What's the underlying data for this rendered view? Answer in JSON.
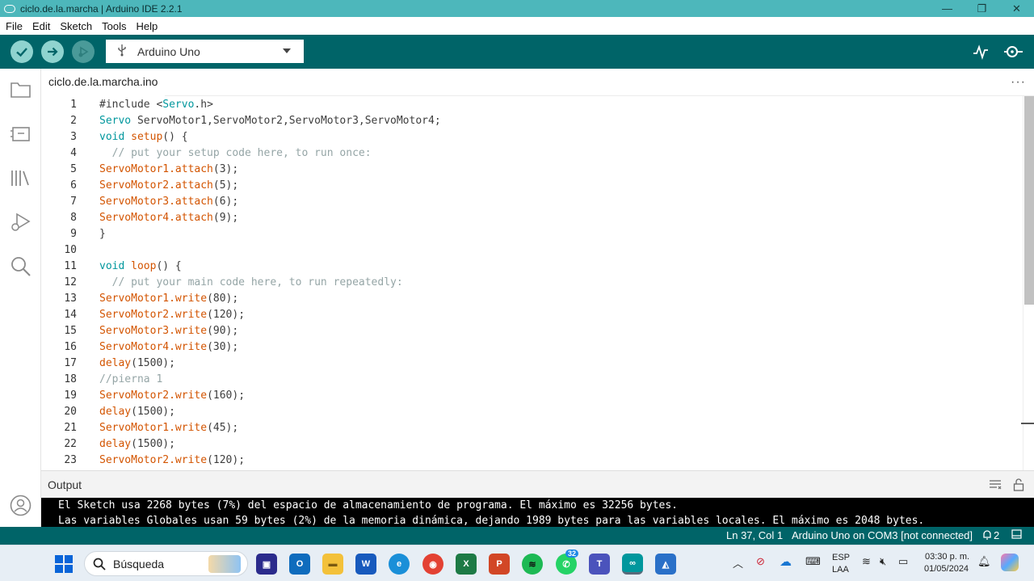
{
  "window": {
    "title": "ciclo.de.la.marcha | Arduino IDE 2.2.1",
    "minimize": "—",
    "restore": "❐",
    "close": "✕"
  },
  "menu": [
    "File",
    "Edit",
    "Sketch",
    "Tools",
    "Help"
  ],
  "toolbar": {
    "board": "Arduino Uno",
    "verify_icon": "check-icon",
    "upload_icon": "arrow-right-icon",
    "debug_icon": "debug-icon",
    "serial_plotter_icon": "pulse-icon",
    "serial_monitor_icon": "magnifier-icon"
  },
  "tab": {
    "filename": "ciclo.de.la.marcha.ino",
    "more": "···"
  },
  "code": [
    {
      "n": "1",
      "text": "#include <Servo.h>"
    },
    {
      "n": "2",
      "text": "Servo ServoMotor1,ServoMotor2,ServoMotor3,ServoMotor4;"
    },
    {
      "n": "3",
      "text": "void setup() {"
    },
    {
      "n": "4",
      "text": "  // put your setup code here, to run once:"
    },
    {
      "n": "5",
      "text": "ServoMotor1.attach(3);"
    },
    {
      "n": "6",
      "text": "ServoMotor2.attach(5);"
    },
    {
      "n": "7",
      "text": "ServoMotor3.attach(6);"
    },
    {
      "n": "8",
      "text": "ServoMotor4.attach(9);"
    },
    {
      "n": "9",
      "text": "}"
    },
    {
      "n": "10",
      "text": ""
    },
    {
      "n": "11",
      "text": "void loop() {"
    },
    {
      "n": "12",
      "text": "  // put your main code here, to run repeatedly:"
    },
    {
      "n": "13",
      "text": "ServoMotor1.write(80);"
    },
    {
      "n": "14",
      "text": "ServoMotor2.write(120);"
    },
    {
      "n": "15",
      "text": "ServoMotor3.write(90);"
    },
    {
      "n": "16",
      "text": "ServoMotor4.write(30);"
    },
    {
      "n": "17",
      "text": "delay(1500);"
    },
    {
      "n": "18",
      "text": "//pierna 1"
    },
    {
      "n": "19",
      "text": "ServoMotor2.write(160);"
    },
    {
      "n": "20",
      "text": "delay(1500);"
    },
    {
      "n": "21",
      "text": "ServoMotor1.write(45);"
    },
    {
      "n": "22",
      "text": "delay(1500);"
    },
    {
      "n": "23",
      "text": "ServoMotor2.write(120);"
    }
  ],
  "output": {
    "label": "Output",
    "lines": [
      "El Sketch usa 2268 bytes (7%) del espacio de almacenamiento de programa. El máximo es 32256 bytes.",
      "Las variables Globales usan 59 bytes (2%) de la memoria dinámica, dejando 1989 bytes para las variables locales. El máximo es 2048 bytes."
    ]
  },
  "status": {
    "position": "Ln 37, Col 1",
    "board": "Arduino Uno on COM3 [not connected]",
    "notifications": "2"
  },
  "taskbar": {
    "search_placeholder": "Búsqueda",
    "whatsapp_badge": "32",
    "lang1": "ESP",
    "lang2": "LAA",
    "time": "03:30 p. m.",
    "date": "01/05/2024"
  },
  "colors": {
    "teal": "#006468",
    "titlebar": "#4db7bb",
    "keyword": "#00979d",
    "function": "#d35400",
    "comment": "#95a5a6"
  }
}
